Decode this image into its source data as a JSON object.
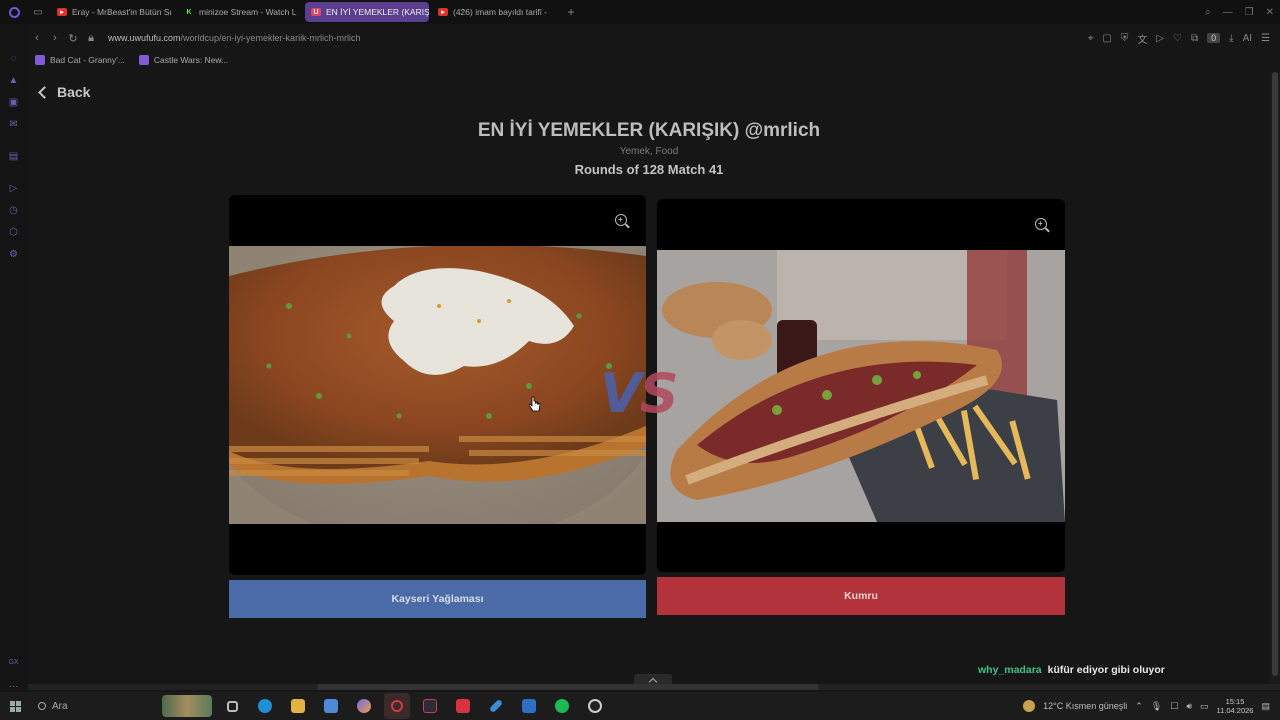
{
  "browser": {
    "tabs": [
      {
        "label": "Eray - MrBeast'in Bütün Sı",
        "icon": "youtube-icon",
        "color": "#e0302a",
        "active": false
      },
      {
        "label": "minizoe Stream - Watch L",
        "icon": "kick-icon",
        "color": "#53fc18",
        "active": false
      },
      {
        "label": "EN İYİ YEMEKLER (KARIŞI",
        "icon": "uwufufu-icon",
        "color": "#e8435e",
        "active": true
      },
      {
        "label": "(426) imam bayıldı tarifi -",
        "icon": "youtube-icon",
        "color": "#e0302a",
        "active": false
      }
    ],
    "new_tab": "+",
    "url_host": "www.uwufufu.com",
    "url_path": "/worldcup/en-iyi-yemekler-kariik-mrlich-mrlich",
    "tab_counter": "0",
    "ai_label": "AI",
    "bookmarks": [
      {
        "label": "Bad Cat - Granny'..."
      },
      {
        "label": "Castle Wars: New..."
      }
    ]
  },
  "page": {
    "back_label": "Back",
    "title": "EN İYİ YEMEKLER (KARIŞIK) @mrlich",
    "tags": "Yemek, Food",
    "round_info": "Rounds of 128 Match 41",
    "vs_v": "V",
    "vs_s": "S",
    "left_choice": {
      "label": "Kayseri Yağlaması",
      "color": "#4b6aa8"
    },
    "right_choice": {
      "label": "Kumru",
      "color": "#b2333b"
    },
    "chat": {
      "user": "why_madara",
      "message": "küfür ediyor gibi oluyor"
    }
  },
  "taskbar": {
    "search_placeholder": "Ara",
    "weather": "12°C  Kısmen güneşli",
    "time": "15:15",
    "date": "11.04.2026"
  }
}
